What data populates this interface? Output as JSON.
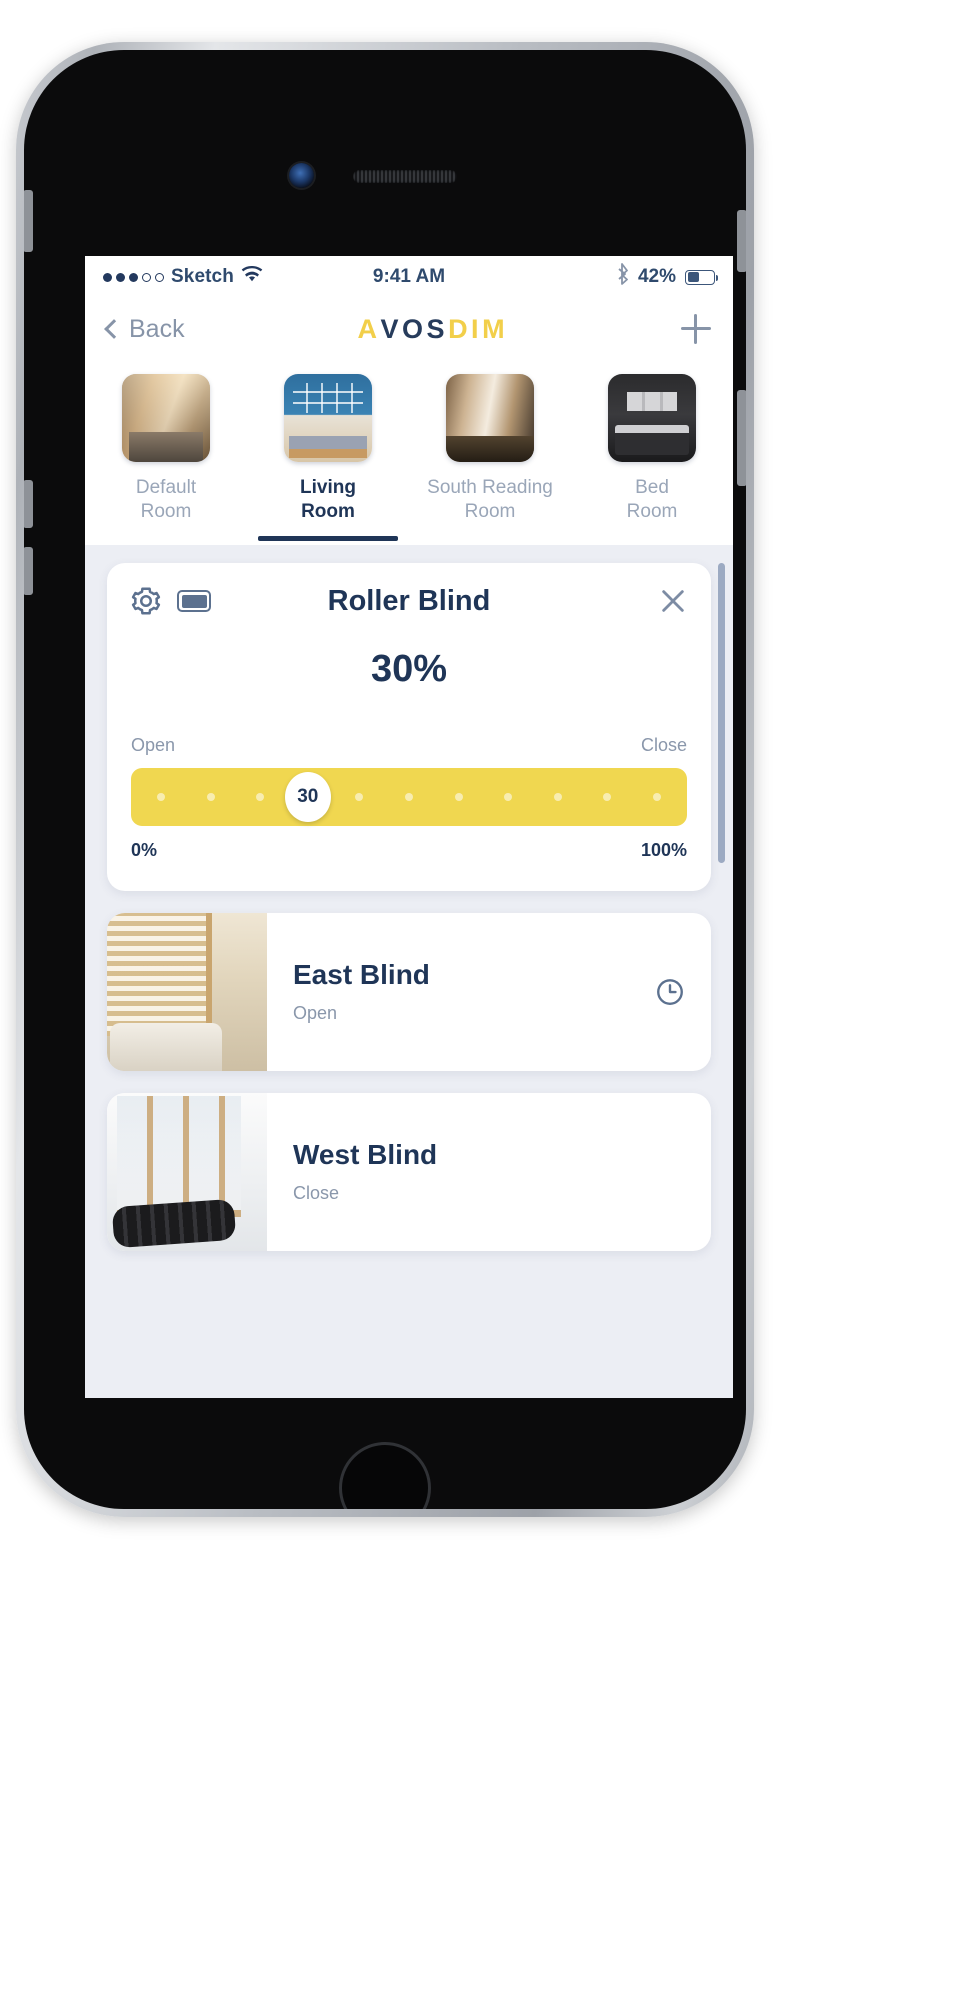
{
  "status_bar": {
    "signal_dots_filled": 3,
    "signal_dots_total": 5,
    "carrier": "Sketch",
    "wifi_icon": "wifi-icon",
    "time": "9:41 AM",
    "bluetooth_icon": "bluetooth-icon",
    "battery_percent": "42%",
    "battery_level": 42
  },
  "navbar": {
    "back_label": "Back",
    "back_icon": "chevron-left-icon",
    "logo_part1": "A",
    "logo_part2": "VOS",
    "logo_part3": "DIM",
    "add_icon": "plus-icon"
  },
  "rooms": {
    "items": [
      {
        "name_line1": "Default",
        "name_line2": "Room",
        "active": false,
        "thumb": "living-room-photo"
      },
      {
        "name_line1": "Living",
        "name_line2": "Room",
        "active": true,
        "thumb": "dining-room-photo"
      },
      {
        "name_line1": "South Reading",
        "name_line2": "Room",
        "active": false,
        "thumb": "reading-room-photo"
      },
      {
        "name_line1": "Bed",
        "name_line2": "Room",
        "active": false,
        "thumb": "bedroom-photo"
      }
    ]
  },
  "roller_card": {
    "settings_icon": "gear-icon",
    "battery_icon": "battery-icon",
    "title": "Roller Blind",
    "close_icon": "close-icon",
    "percent_display": "30%",
    "open_label": "Open",
    "close_label": "Close",
    "slider_value": "30",
    "slider_value_number": 30,
    "slider_tick_count": 11,
    "range_min_label": "0%",
    "range_max_label": "100%"
  },
  "devices": [
    {
      "name": "East Blind",
      "state": "Open",
      "image": "east-blind-photo",
      "action_icon": "clock-icon",
      "has_action_icon": true
    },
    {
      "name": "West Blind",
      "state": "Close",
      "image": "west-blind-photo",
      "action_icon": "",
      "has_action_icon": false
    }
  ],
  "colors": {
    "accent_yellow": "#f0d750",
    "navy": "#1f3557",
    "muted": "#8a97ab",
    "screen_bg": "#eceef4"
  }
}
